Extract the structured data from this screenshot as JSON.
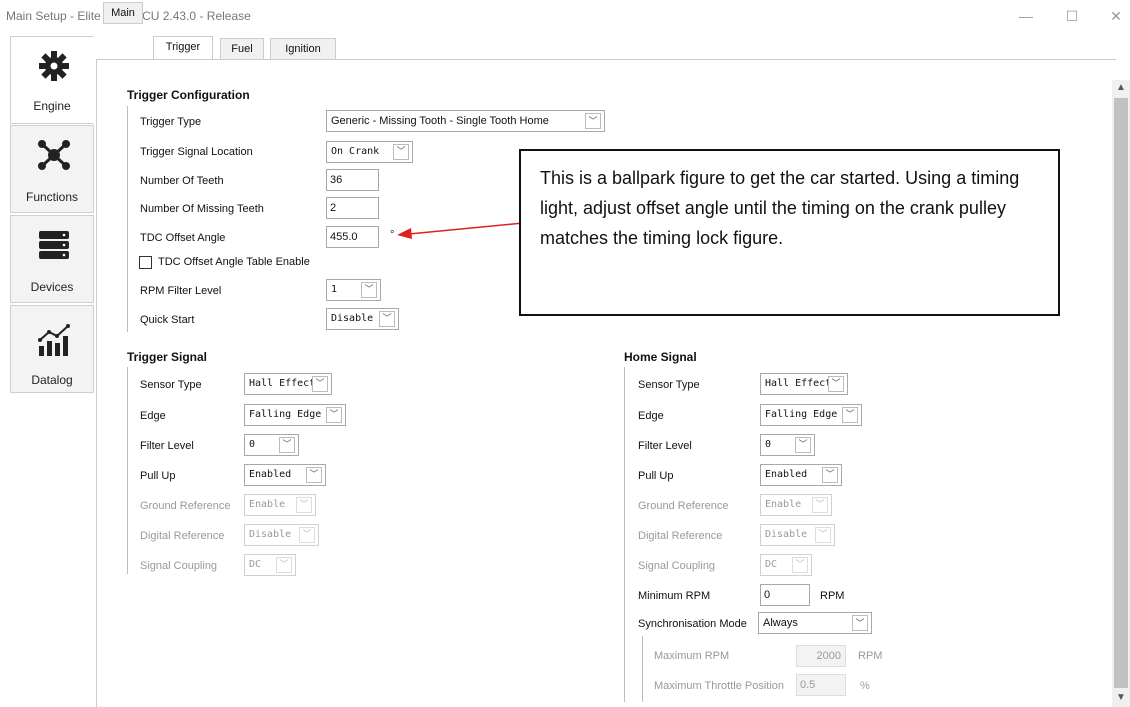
{
  "window": {
    "title": "Main Setup - Elite 1500 ECU 2.43.0 - Release",
    "minimize": "—",
    "maximize": "☐",
    "close": "✕"
  },
  "sidebar": {
    "items": [
      {
        "label": "Engine",
        "icon": "gear-icon"
      },
      {
        "label": "Functions",
        "icon": "nodes-icon"
      },
      {
        "label": "Devices",
        "icon": "server-icon"
      },
      {
        "label": "Datalog",
        "icon": "chart-icon"
      }
    ]
  },
  "tabs": [
    "Main",
    "Trigger",
    "Fuel",
    "Ignition"
  ],
  "trigger_config": {
    "heading": "Trigger Configuration",
    "trigger_type": {
      "label": "Trigger Type",
      "value": "Generic - Missing Tooth - Single Tooth Home"
    },
    "signal_location": {
      "label": "Trigger Signal Location",
      "value": "On Crank"
    },
    "num_teeth": {
      "label": "Number Of Teeth",
      "value": "36"
    },
    "missing_teeth": {
      "label": "Number Of Missing Teeth",
      "value": "2"
    },
    "tdc_offset": {
      "label": "TDC Offset Angle",
      "value": "455.0",
      "unit": "°"
    },
    "tdc_table": {
      "label": "TDC Offset Angle Table Enable"
    },
    "rpm_filter": {
      "label": "RPM Filter Level",
      "value": "1"
    },
    "quick_start": {
      "label": "Quick Start",
      "value": "Disable"
    }
  },
  "callout": {
    "text": "This is a ballpark figure to get the car started. Using a timing light, adjust offset angle until the timing on the crank pulley matches the timing lock figure."
  },
  "trigger_signal": {
    "heading": "Trigger Signal",
    "sensor_type": {
      "label": "Sensor Type",
      "value": "Hall Effect"
    },
    "edge": {
      "label": "Edge",
      "value": "Falling Edge"
    },
    "filter_level": {
      "label": "Filter Level",
      "value": "0"
    },
    "pull_up": {
      "label": "Pull Up",
      "value": "Enabled"
    },
    "ground_ref": {
      "label": "Ground Reference",
      "value": "Enable"
    },
    "digital_ref": {
      "label": "Digital Reference",
      "value": "Disable"
    },
    "coupling": {
      "label": "Signal Coupling",
      "value": "DC"
    }
  },
  "home_signal": {
    "heading": "Home Signal",
    "sensor_type": {
      "label": "Sensor Type",
      "value": "Hall Effect"
    },
    "edge": {
      "label": "Edge",
      "value": "Falling Edge"
    },
    "filter_level": {
      "label": "Filter Level",
      "value": "0"
    },
    "pull_up": {
      "label": "Pull Up",
      "value": "Enabled"
    },
    "ground_ref": {
      "label": "Ground Reference",
      "value": "Enable"
    },
    "digital_ref": {
      "label": "Digital Reference",
      "value": "Disable"
    },
    "coupling": {
      "label": "Signal Coupling",
      "value": "DC"
    },
    "min_rpm": {
      "label": "Minimum RPM",
      "value": "0",
      "unit": "RPM"
    },
    "sync_mode": {
      "label": "Synchronisation Mode",
      "value": "Always"
    },
    "max_rpm": {
      "label": "Maximum RPM",
      "value": "2000",
      "unit": "RPM"
    },
    "max_throttle": {
      "label": "Maximum Throttle Position",
      "value": "0.5",
      "unit": "%"
    }
  },
  "colors": {
    "arrow": "#e02020",
    "accent": "#111111"
  }
}
